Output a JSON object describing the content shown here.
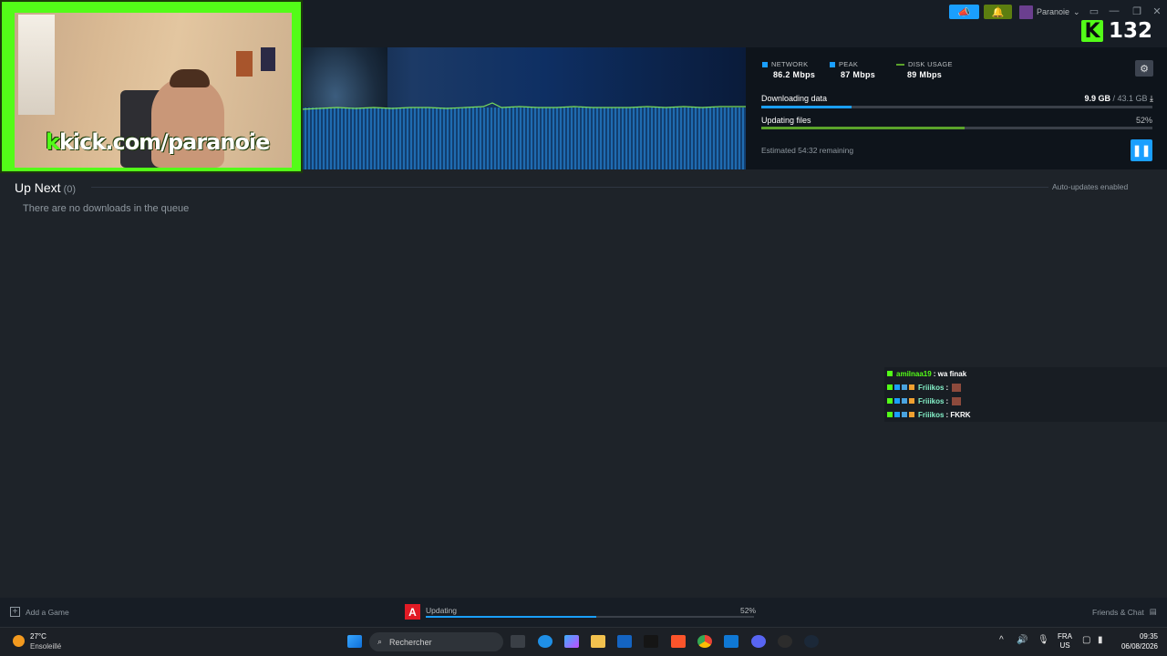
{
  "topbar": {
    "user_name": "Paranoie",
    "user_chevron": "⌄"
  },
  "kick_overlay": {
    "follower_count": "132",
    "logo_letter": "K",
    "url_prefix": "k",
    "url": "kick.com/paranoie"
  },
  "stats": {
    "network_label": "NETWORK",
    "network_value": "86.2 Mbps",
    "peak_label": "PEAK",
    "peak_value": "87 Mbps",
    "disk_label": "DISK USAGE",
    "disk_value": "89 Mbps"
  },
  "download": {
    "row1_label": "Downloading data",
    "row1_value": "9.9 GB",
    "row1_total": " / 43.1 GB",
    "row1_progress": 0.23,
    "row2_label": "Updating files",
    "row2_value": "52%",
    "row2_progress": 0.52,
    "eta": "Estimated 54:32 remaining"
  },
  "queue": {
    "title": "Up Next",
    "count": "(0)",
    "auto_updates": "Auto-updates enabled",
    "empty_message": "There are no downloads in the queue"
  },
  "chat": {
    "messages": [
      {
        "user": "amilnaa19",
        "text": ": wa finak"
      },
      {
        "user": "Friiikos",
        "text": " :"
      },
      {
        "user": "Friiikos",
        "text": " :"
      },
      {
        "user": "Friiikos",
        "text": " : FKRK"
      }
    ]
  },
  "statusbar": {
    "add_game": "Add a Game",
    "updating_label": "Updating",
    "updating_pct": "52%",
    "updating_progress": 0.52,
    "friends_chat": "Friends & Chat"
  },
  "taskbar": {
    "weather_temp": "27°C",
    "weather_condition": "Ensoleillé",
    "search_placeholder": "Rechercher",
    "lang_line1": "FRA",
    "lang_line2": "US",
    "time": "09:35",
    "date": "06/08/2026"
  },
  "colors": {
    "kick_green": "#53fc18",
    "steam_blue": "#1a9fff",
    "progress_green": "#5ba32b"
  }
}
